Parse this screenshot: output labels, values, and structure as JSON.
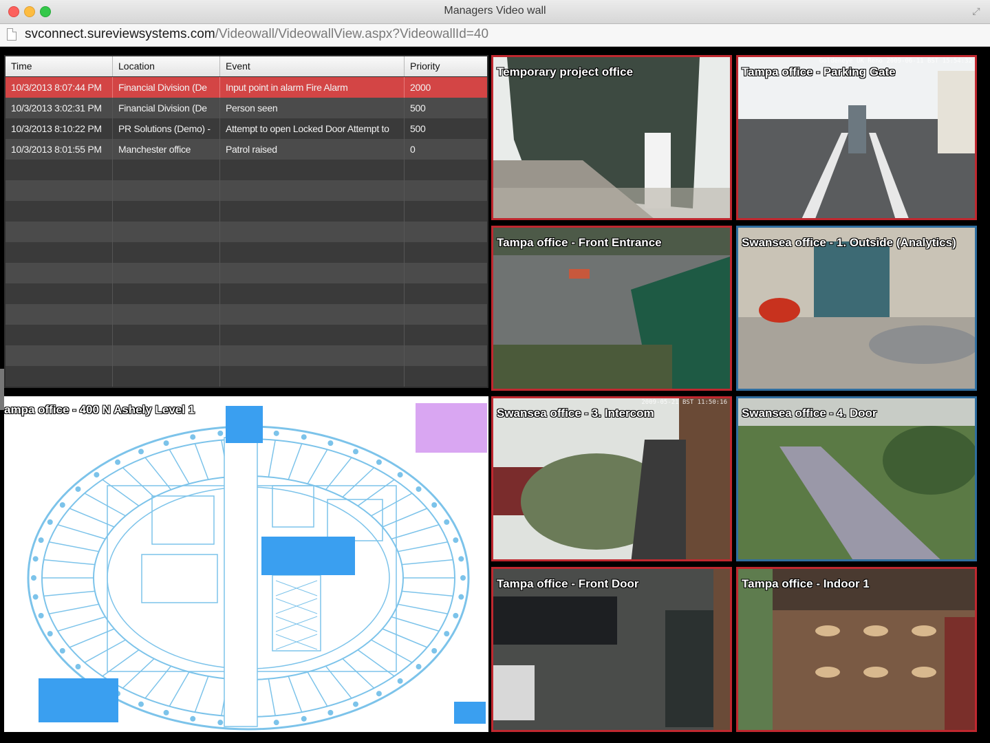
{
  "window": {
    "title": "Managers Video wall",
    "url_host": "svconnect.sureviewsystems.com",
    "url_path": "/Videowall/VideowallView.aspx?VideowallId=40"
  },
  "events": {
    "columns": [
      "Time",
      "Location",
      "Event",
      "Priority"
    ],
    "rows": [
      {
        "time": "10/3/2013 8:07:44 PM",
        "location": "Financial Division (De",
        "event": "Input point in alarm Fire Alarm",
        "priority": "2000",
        "alarm": true
      },
      {
        "time": "10/3/2013 3:02:31 PM",
        "location": "Financial Division (De",
        "event": " Person seen",
        "priority": "500",
        "alarm": false
      },
      {
        "time": "10/3/2013 8:10:22 PM",
        "location": "PR Solutions (Demo) -",
        "event": "Attempt to open Locked Door Attempt to",
        "priority": "500",
        "alarm": false
      },
      {
        "time": "10/3/2013 8:01:55 PM",
        "location": "Manchester office",
        "event": "Patrol raised",
        "priority": "0",
        "alarm": false
      }
    ],
    "empty_rows": 11,
    "alarm_color": "#d34545"
  },
  "map": {
    "title": "ampa office - 400 N Ashely Level 1",
    "line_color": "#7cc3ea",
    "zone_color": "#3a9ff0",
    "alert_zone_color": "#d9a6f2"
  },
  "cameras": [
    {
      "label": "Temporary project office",
      "stamp": "",
      "border": "red",
      "scene": "building"
    },
    {
      "label": "Tampa office - Parking Gate",
      "stamp": "Goldeneye UK Reno 2009-06-11 BST 15:54:32",
      "border": "red",
      "scene": "road"
    },
    {
      "label": "Tampa office - Front Entrance",
      "stamp": "",
      "border": "red",
      "scene": "parking"
    },
    {
      "label": "Swansea office - 1. Outside (Analytics)",
      "stamp": "",
      "border": "blue",
      "scene": "doors"
    },
    {
      "label": "Swansea office - 3. Intercom",
      "stamp": "2009-05-21 BST 11:50:16",
      "border": "red",
      "scene": "garden"
    },
    {
      "label": "Swansea office - 4. Door",
      "stamp": "",
      "border": "blue",
      "scene": "path"
    },
    {
      "label": "Tampa office - Front Door",
      "stamp": "",
      "border": "red",
      "scene": "frontdoor"
    },
    {
      "label": "Tampa office - Indoor 1",
      "stamp": "",
      "border": "red",
      "scene": "indoor"
    }
  ]
}
